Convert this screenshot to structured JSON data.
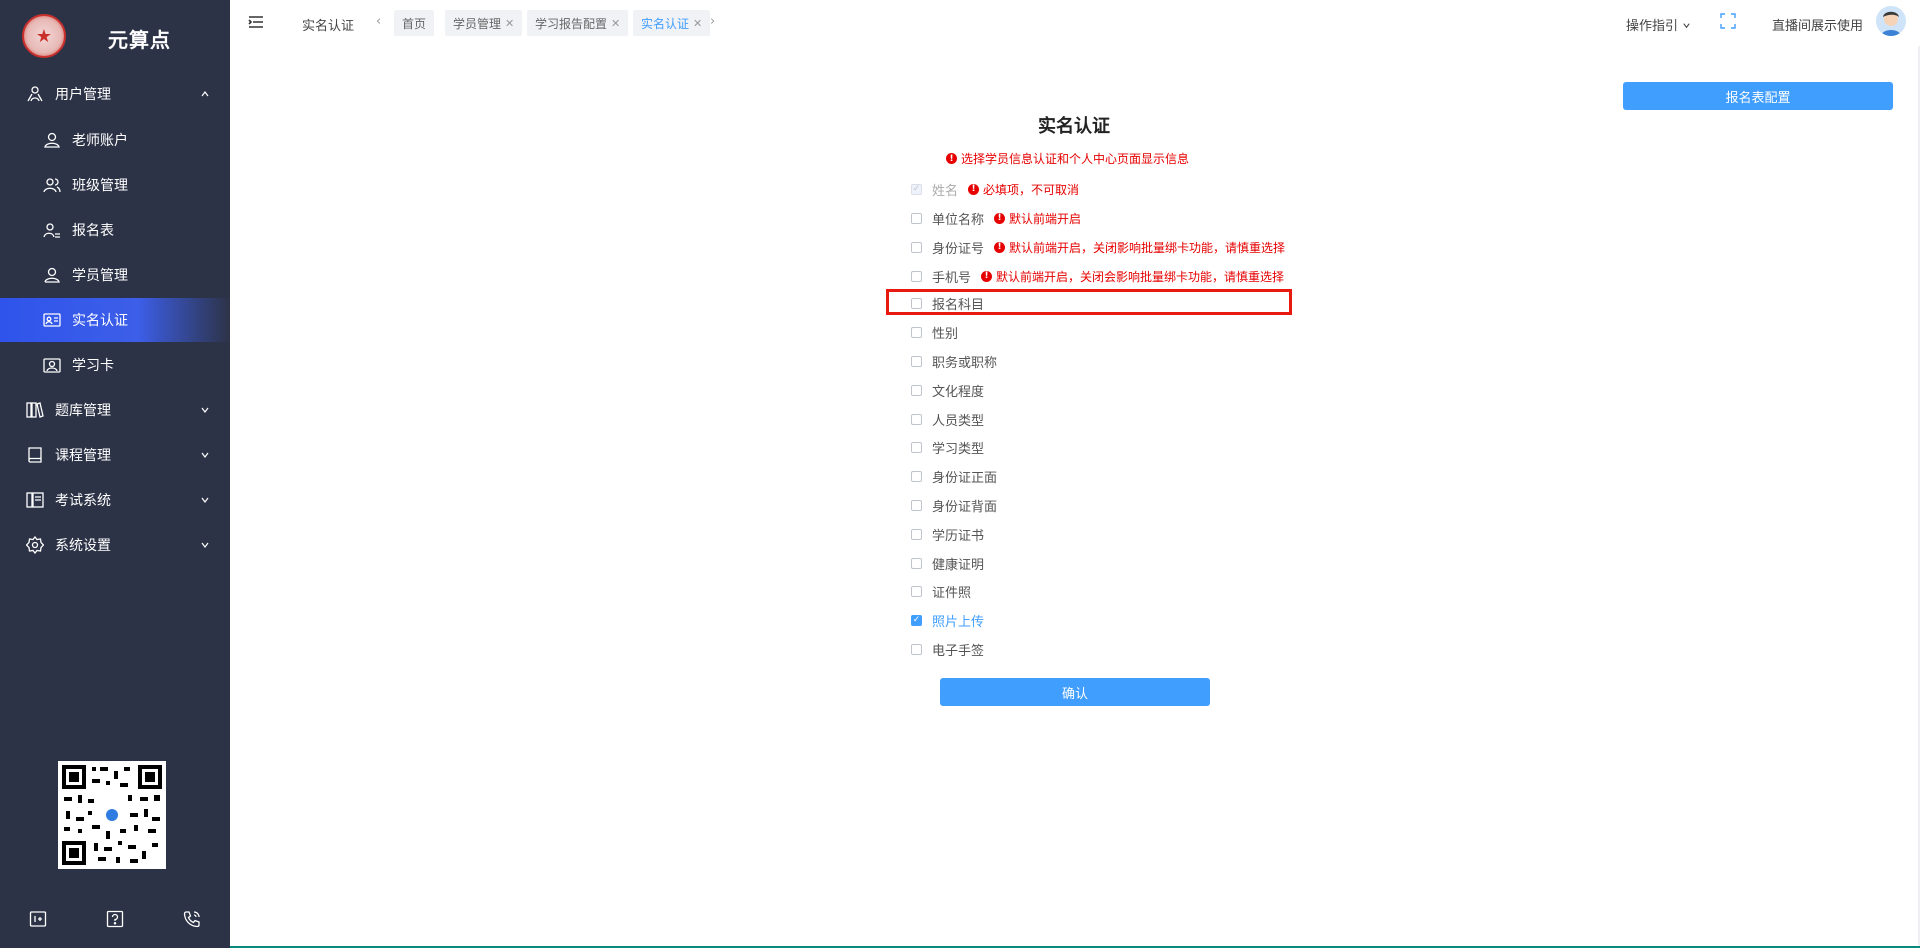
{
  "app": {
    "name": "元算点"
  },
  "sidebar": {
    "groups": [
      {
        "label": "用户管理",
        "icon": "user-group-icon",
        "expanded": true,
        "items": [
          {
            "label": "老师账户",
            "icon": "user-icon"
          },
          {
            "label": "班级管理",
            "icon": "users-icon"
          },
          {
            "label": "报名表",
            "icon": "user-form-icon"
          },
          {
            "label": "学员管理",
            "icon": "student-icon"
          },
          {
            "label": "实名认证",
            "icon": "id-card-icon",
            "active": true
          },
          {
            "label": "学习卡",
            "icon": "card-icon"
          }
        ]
      },
      {
        "label": "题库管理",
        "icon": "books-icon",
        "expanded": false
      },
      {
        "label": "课程管理",
        "icon": "book-icon",
        "expanded": false
      },
      {
        "label": "考试系统",
        "icon": "exam-icon",
        "expanded": false
      },
      {
        "label": "系统设置",
        "icon": "gear-icon",
        "expanded": false
      }
    ],
    "bottom_icons": [
      "panel-icon",
      "help-icon",
      "phone-icon"
    ]
  },
  "topbar": {
    "page_label": "实名认证",
    "tabs": [
      {
        "label": "首页",
        "closable": false
      },
      {
        "label": "学员管理",
        "closable": true
      },
      {
        "label": "学习报告配置",
        "closable": true
      },
      {
        "label": "实名认证",
        "closable": true,
        "active": true
      }
    ],
    "guide": "操作指引",
    "user": "直播间展示使用"
  },
  "main": {
    "config_button": "报名表配置",
    "title": "实名认证",
    "hint": "选择学员信息认证和个人中心页面显示信息",
    "fields": [
      {
        "label": "姓名",
        "state": "disabled",
        "note": "必填项，不可取消"
      },
      {
        "label": "单位名称",
        "state": "unchecked",
        "note": "默认前端开启"
      },
      {
        "label": "身份证号",
        "state": "unchecked",
        "note": "默认前端开启，关闭影响批量绑卡功能，请慎重选择"
      },
      {
        "label": "手机号",
        "state": "unchecked",
        "note": "默认前端开启，关闭会影响批量绑卡功能，请慎重选择"
      },
      {
        "label": "报名科目",
        "state": "unchecked",
        "note": ""
      },
      {
        "label": "性别",
        "state": "unchecked",
        "note": ""
      },
      {
        "label": "职务或职称",
        "state": "unchecked",
        "note": ""
      },
      {
        "label": "文化程度",
        "state": "unchecked",
        "note": ""
      },
      {
        "label": "人员类型",
        "state": "unchecked",
        "note": ""
      },
      {
        "label": "学习类型",
        "state": "unchecked",
        "note": ""
      },
      {
        "label": "身份证正面",
        "state": "unchecked",
        "note": ""
      },
      {
        "label": "身份证背面",
        "state": "unchecked",
        "note": ""
      },
      {
        "label": "学历证书",
        "state": "unchecked",
        "note": ""
      },
      {
        "label": "健康证明",
        "state": "unchecked",
        "note": ""
      },
      {
        "label": "证件照",
        "state": "unchecked",
        "note": ""
      },
      {
        "label": "照片上传",
        "state": "checked",
        "note": ""
      },
      {
        "label": "电子手签",
        "state": "unchecked",
        "note": ""
      }
    ],
    "confirm_button": "确认"
  },
  "colors": {
    "sidebar_bg": "#2d3347",
    "primary": "#409eff",
    "active_item": "#2f54eb",
    "warning": "#e60000",
    "highlight_box": "#e8190f"
  }
}
